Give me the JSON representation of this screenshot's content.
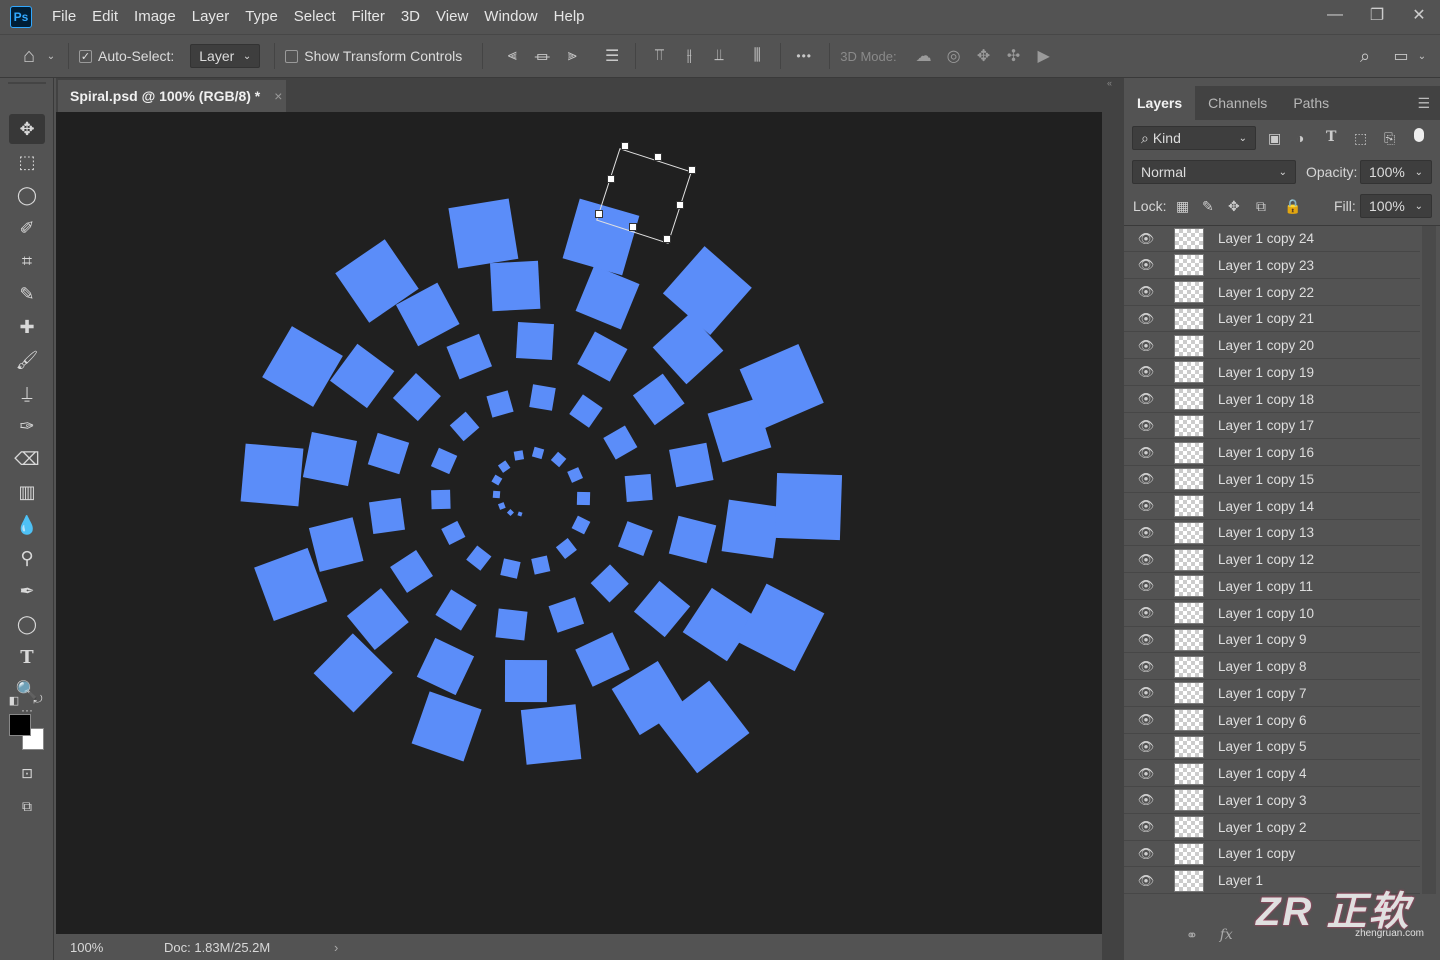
{
  "app": {
    "logo": "Ps",
    "accent": "#31a8ff"
  },
  "menu": [
    "File",
    "Edit",
    "Image",
    "Layer",
    "Type",
    "Select",
    "Filter",
    "3D",
    "View",
    "Window",
    "Help"
  ],
  "window_controls": {
    "minimize": "—",
    "restore": "❐",
    "close": "✕"
  },
  "options": {
    "auto_select_label": "Auto-Select:",
    "auto_select_checked": "✓",
    "auto_select_target": "Layer",
    "show_transform_label": "Show Transform Controls",
    "mode_3d_label": "3D Mode:",
    "more": "•••"
  },
  "document": {
    "tab_title": "Spiral.psd @ 100% (RGB/8) *",
    "close": "×",
    "zoom": "100%",
    "doc_info": "Doc: 1.83M/25.2M"
  },
  "colors": {
    "shape_fill": "#5b8df9",
    "canvas_bg": "#202020"
  },
  "layers_panel": {
    "tabs": [
      "Layers",
      "Channels",
      "Paths"
    ],
    "filter_label": "Kind",
    "blend_mode": "Normal",
    "opacity_label": "Opacity:",
    "opacity_value": "100%",
    "lock_label": "Lock:",
    "fill_label": "Fill:",
    "fill_value": "100%",
    "layers": [
      "Layer 1 copy 24",
      "Layer 1 copy 23",
      "Layer 1 copy 22",
      "Layer 1 copy 21",
      "Layer 1 copy 20",
      "Layer 1 copy 19",
      "Layer 1 copy 18",
      "Layer 1 copy 17",
      "Layer 1 copy 16",
      "Layer 1 copy 15",
      "Layer 1 copy 14",
      "Layer 1 copy 13",
      "Layer 1 copy 12",
      "Layer 1 copy 11",
      "Layer 1 copy 10",
      "Layer 1 copy 9",
      "Layer 1 copy 8",
      "Layer 1 copy 7",
      "Layer 1 copy 6",
      "Layer 1 copy 5",
      "Layer 1 copy 4",
      "Layer 1 copy 3",
      "Layer 1 copy 2",
      "Layer 1 copy",
      "Layer 1"
    ],
    "footer_fx": "fx"
  },
  "watermark": {
    "text": "ZR 正软",
    "sub": "zhengruan.com"
  }
}
